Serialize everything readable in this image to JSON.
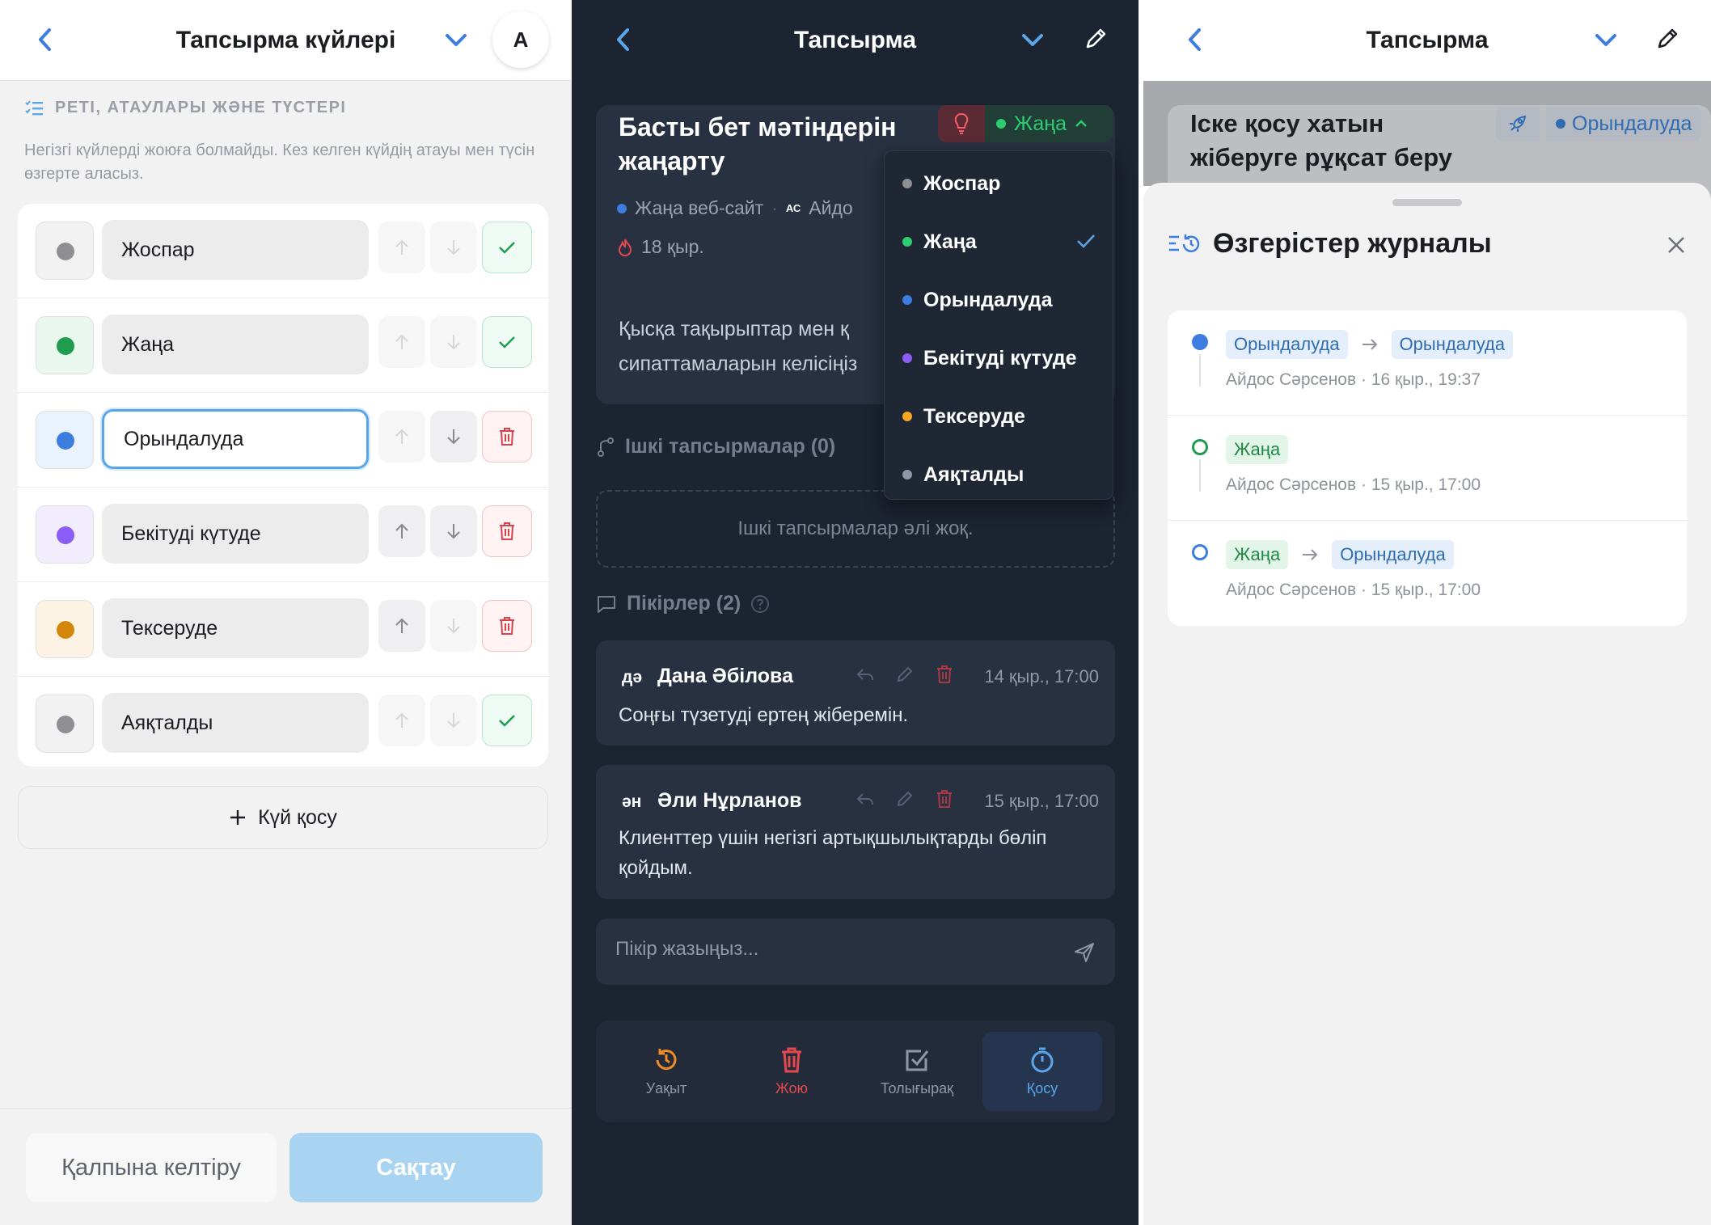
{
  "colors": {
    "accent": "#3d7de0",
    "success": "#1f9d4f",
    "danger": "#d9404a",
    "purple": "#8b5cf6",
    "orange": "#d4860a",
    "gray": "#8e8e93",
    "save_disabled": "#a8d3f1"
  },
  "screen1": {
    "header": {
      "title": "Тапсырма күйлері",
      "avatar": "A",
      "icons": [
        "back-chevron-icon",
        "chevron-down-icon"
      ]
    },
    "section": {
      "title": "РЕТІ, АТАУЛАРЫ ЖӘНЕ ТҮСТЕРІ",
      "description": "Негізгі күйлерді жоюға болмайды. Кез келген күйдің атауы мен түсін өзгерте аласыз."
    },
    "statuses": [
      {
        "name": "Жоспар",
        "color": "#8e8e93",
        "swatch_bg": "#f2f2f3",
        "action": "check-icon"
      },
      {
        "name": "Жаңа",
        "color": "#1f9d4f",
        "swatch_bg": "#e9f7ee",
        "action": "check-icon"
      },
      {
        "name": "Орындалуда",
        "color": "#3d7de0",
        "swatch_bg": "#eaf2fd",
        "action": "trash-icon",
        "focused": true
      },
      {
        "name": "Бекітуді күтуде",
        "color": "#8b5cf6",
        "swatch_bg": "#f2edfd",
        "action": "trash-icon"
      },
      {
        "name": "Тексеруде",
        "color": "#d4860a",
        "swatch_bg": "#fdf3e4",
        "action": "trash-icon"
      },
      {
        "name": "Аяқталды",
        "color": "#8e8e93",
        "swatch_bg": "#f2f2f3",
        "action": "check-icon"
      }
    ],
    "add_button": "Күй қосу",
    "footer": {
      "reset": "Қалпына келтіру",
      "save": "Сақтау"
    }
  },
  "screen2": {
    "header": {
      "title": "Тапсырма"
    },
    "task": {
      "title": "Басты бет мәтіндерін жаңарту",
      "status": "Жаңа",
      "project": "Жаңа веб-сайт",
      "assignee_initials": "АС",
      "assignee": "Айдо",
      "date": "18 қыр.",
      "description_line1": "Қысқа тақырыптар мен қ",
      "description_line2": "сипаттамаларын келісіңіз"
    },
    "dropdown": [
      {
        "label": "Жоспар",
        "color": "#8e8e93"
      },
      {
        "label": "Жаңа",
        "color": "#2ecc71",
        "selected": true
      },
      {
        "label": "Орындалуда",
        "color": "#3d7de0"
      },
      {
        "label": "Бекітуді күтуде",
        "color": "#8b5cf6"
      },
      {
        "label": "Тексеруде",
        "color": "#f5a623"
      },
      {
        "label": "Аяқталды",
        "color": "#8e98a8"
      }
    ],
    "subtasks": {
      "title": "Ішкі тапсырмалар (0)",
      "empty": "Ішкі тапсырмалар әлі жоқ."
    },
    "comments": {
      "title": "Пікірлер (2)",
      "items": [
        {
          "initials": "дә",
          "author": "Дана Әбілова",
          "time": "14 қыр., 17:00",
          "text": "Соңғы түзетуді ертең жіберемін."
        },
        {
          "initials": "ән",
          "author": "Әли Нұрланов",
          "time": "15 қыр., 17:00",
          "text": "Клиенттер үшін негізгі артықшылықтарды бөліп қойдым."
        }
      ]
    },
    "input_placeholder": "Пікір жазыңыз...",
    "tabs": [
      {
        "label": "Уақыт",
        "icon": "history-icon",
        "color": "#f08a24"
      },
      {
        "label": "Жою",
        "icon": "trash-icon",
        "color": "#e5484d"
      },
      {
        "label": "Толығырақ",
        "icon": "checkbox-icon",
        "color": "#8e98a8"
      },
      {
        "label": "Қосу",
        "icon": "timer-icon",
        "color": "#5aa6e8",
        "active": true
      }
    ]
  },
  "screen3": {
    "header": {
      "title": "Тапсырма"
    },
    "task": {
      "title": "Іске қосу хатын жіберуге рұқсат беру",
      "status": "Орындалуда"
    },
    "sheet": {
      "title": "Өзгерістер журналы"
    },
    "log": [
      {
        "from": "Орындалуда",
        "from_color": "blue",
        "to": "Орындалуда",
        "to_color": "blue",
        "author": "Айдос Сәрсенов",
        "time": "16 қыр., 19:37",
        "dot": "filled-blue"
      },
      {
        "from": "Жаңа",
        "from_color": "green",
        "to": "",
        "author": "Айдос Сәрсенов",
        "time": "15 қыр., 17:00",
        "dot": "ring-green"
      },
      {
        "from": "Жаңа",
        "from_color": "green",
        "to": "Орындалуда",
        "to_color": "blue",
        "author": "Айдос Сәрсенов",
        "time": "15 қыр., 17:00",
        "dot": "ring-blue"
      }
    ]
  }
}
